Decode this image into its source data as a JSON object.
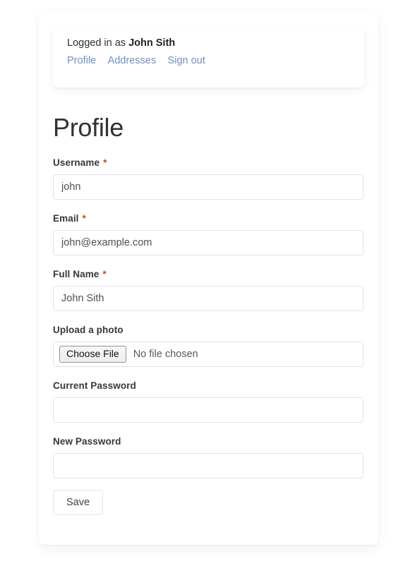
{
  "session": {
    "logged_in_prefix": "Logged in as",
    "user_name": "John Sith",
    "links": [
      {
        "label": "Profile"
      },
      {
        "label": "Addresses"
      },
      {
        "label": "Sign out"
      }
    ]
  },
  "page": {
    "title": "Profile"
  },
  "form": {
    "required_marker": "*",
    "fields": [
      {
        "label": "Username",
        "required": true,
        "value": "john",
        "placeholder": "",
        "type": "text"
      },
      {
        "label": "Email",
        "required": true,
        "value": "john@example.com",
        "placeholder": "",
        "type": "email"
      },
      {
        "label": "Full Name",
        "required": true,
        "value": "John Sith",
        "placeholder": "",
        "type": "text"
      },
      {
        "label": "Upload a photo",
        "required": false,
        "type": "file",
        "button_label": "Choose File",
        "status_text": "No file chosen"
      },
      {
        "label": "Current Password",
        "required": false,
        "value": "",
        "placeholder": "",
        "type": "password"
      },
      {
        "label": "New Password",
        "required": false,
        "value": "",
        "placeholder": "",
        "type": "password"
      }
    ],
    "submit_label": "Save"
  },
  "colors": {
    "link": "#6f8fc4",
    "required_star": "#cf4520",
    "label_text": "#32383e",
    "title_text": "#2e3338",
    "input_border": "#dfe2e5",
    "input_text": "#4a5158",
    "page_background": "#ffffff",
    "card_background": "#ffffff"
  }
}
